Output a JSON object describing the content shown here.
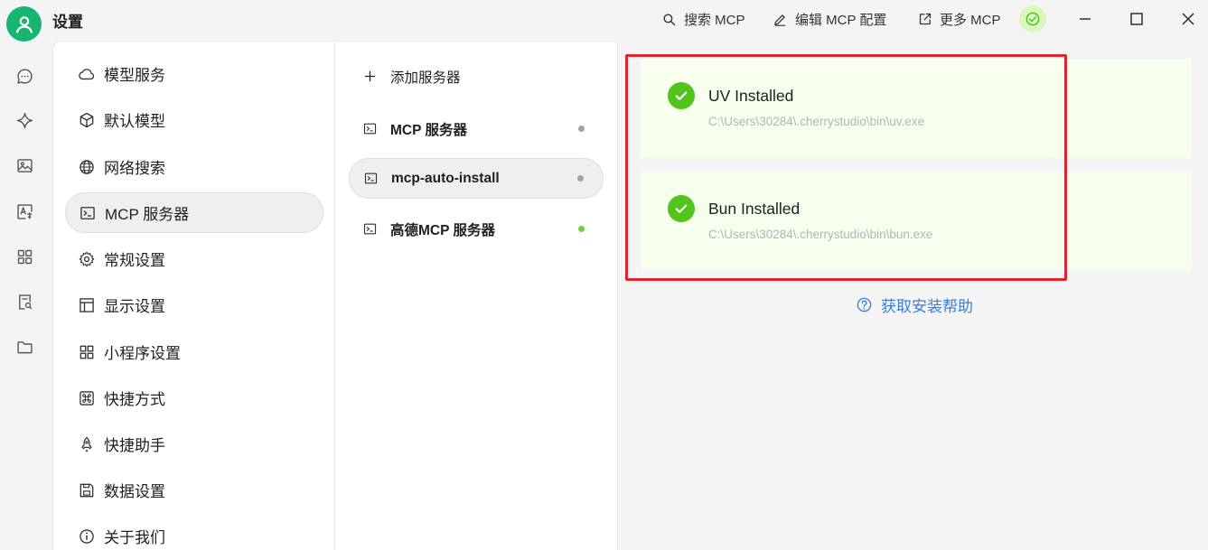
{
  "app": {
    "title": "设置"
  },
  "titlebar": {
    "search_mcp": "搜索 MCP",
    "edit_mcp_config": "编辑 MCP 配置",
    "more_mcp": "更多 MCP"
  },
  "settings_menu": {
    "items": [
      {
        "label": "模型服务",
        "icon": "cloud-icon"
      },
      {
        "label": "默认模型",
        "icon": "cube-icon"
      },
      {
        "label": "网络搜索",
        "icon": "globe-icon"
      },
      {
        "label": "MCP 服务器",
        "icon": "terminal-icon",
        "active": true
      },
      {
        "label": "常规设置",
        "icon": "gear-icon"
      },
      {
        "label": "显示设置",
        "icon": "layout-icon"
      },
      {
        "label": "小程序设置",
        "icon": "grid-icon"
      },
      {
        "label": "快捷方式",
        "icon": "command-icon"
      },
      {
        "label": "快捷助手",
        "icon": "rocket-icon"
      },
      {
        "label": "数据设置",
        "icon": "save-icon"
      },
      {
        "label": "关于我们",
        "icon": "info-icon"
      }
    ]
  },
  "server_list": {
    "add_label": "添加服务器",
    "items": [
      {
        "label": "MCP 服务器",
        "status": "inactive",
        "status_color": "#a3a3a3"
      },
      {
        "label": "mcp-auto-install",
        "status": "inactive",
        "status_color": "#a3a3a3",
        "active": true
      },
      {
        "label": "高德MCP 服务器",
        "status": "active",
        "status_color": "#52c41a"
      }
    ]
  },
  "install_status": {
    "uv": {
      "title": "UV Installed",
      "path": "C:\\Users\\30284\\.cherrystudio\\bin\\uv.exe"
    },
    "bun": {
      "title": "Bun Installed",
      "path": "C:\\Users\\30284\\.cherrystudio\\bin\\bun.exe"
    },
    "help_link": "获取安装帮助"
  },
  "colors": {
    "accent": "#17b56f",
    "success": "#52c41a",
    "highlight": "#e3222d",
    "link": "#3b7ddd"
  }
}
